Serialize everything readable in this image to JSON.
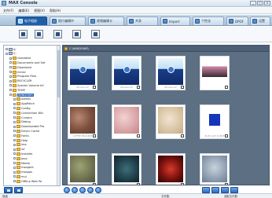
{
  "window": {
    "title": "MAX Console",
    "controls": [
      "_",
      "□",
      "×"
    ]
  },
  "menubar": {
    "items": [
      "文件(F)",
      "编辑(E)",
      "视图(V)",
      "帮助(H)"
    ]
  },
  "tabs": [
    {
      "label": "电子相册",
      "icon": "album-icon",
      "active": true
    },
    {
      "label": "照片编辑中",
      "icon": "photo-edit-icon"
    },
    {
      "label": "视频编辑卡",
      "icon": "video-edit-icon"
    },
    {
      "label": "共享",
      "icon": "share-icon"
    },
    {
      "label": "Import",
      "icon": "import-icon"
    },
    {
      "label": "个性化",
      "icon": "personalize-icon"
    },
    {
      "label": "DPOF",
      "icon": "dpof-icon"
    },
    {
      "label": "设置",
      "icon": "settings-icon"
    }
  ],
  "toolbar": {
    "buttons": [
      "tool-button-1",
      "tool-button-2",
      "tool-button-3",
      "tool-button-4",
      "tool-button-5"
    ]
  },
  "tree": {
    "items": [
      {
        "label": "A:",
        "type": "drive",
        "indent": 0
      },
      {
        "label": "C:",
        "type": "drive",
        "indent": 0
      },
      {
        "label": "clsmaster",
        "type": "folder",
        "indent": 1
      },
      {
        "label": "Documents and Set",
        "type": "folder",
        "indent": 1
      },
      {
        "label": "Download",
        "type": "folder",
        "indent": 1
      },
      {
        "label": "mirror",
        "type": "folder",
        "indent": 1
      },
      {
        "label": "Program Files",
        "type": "folder",
        "indent": 1
      },
      {
        "label": "RECYCLER",
        "type": "folder",
        "indent": 1
      },
      {
        "label": "System Volume Inf",
        "type": "folder",
        "indent": 1
      },
      {
        "label": "TEMP",
        "type": "folder",
        "indent": 1
      },
      {
        "label": "WINDOWS",
        "type": "folder",
        "indent": 1,
        "selected": true
      },
      {
        "label": "addins",
        "type": "folder",
        "indent": 2
      },
      {
        "label": "AppPatch",
        "type": "folder",
        "indent": 2
      },
      {
        "label": "Config",
        "type": "folder",
        "indent": 2
      },
      {
        "label": "Connection Wiz",
        "type": "folder",
        "indent": 2
      },
      {
        "label": "Cursors",
        "type": "folder",
        "indent": 2
      },
      {
        "label": "Debug",
        "type": "folder",
        "indent": 2
      },
      {
        "label": "Downloaded Pro",
        "type": "folder",
        "indent": 2
      },
      {
        "label": "Driver Cache",
        "type": "folder",
        "indent": 2
      },
      {
        "label": "Fonts",
        "type": "folder",
        "indent": 2
      },
      {
        "label": "Help",
        "type": "folder",
        "indent": 2
      },
      {
        "label": "ime",
        "type": "folder",
        "indent": 2
      },
      {
        "label": "inf",
        "type": "folder",
        "indent": 2
      },
      {
        "label": "Installer",
        "type": "folder",
        "indent": 2
      },
      {
        "label": "java",
        "type": "folder",
        "indent": 2
      },
      {
        "label": "Media",
        "type": "folder",
        "indent": 2
      },
      {
        "label": "msagent",
        "type": "folder",
        "indent": 2
      },
      {
        "label": "msapps",
        "type": "folder",
        "indent": 2
      },
      {
        "label": "mui",
        "type": "folder",
        "indent": 2
      },
      {
        "label": "Offline Web Pa",
        "type": "folder",
        "indent": 2
      }
    ]
  },
  "path_bar": {
    "text": "C:\\WINDOWS\\"
  },
  "thumbnails": [
    {
      "caption": "Windows XP",
      "style": "img-intro"
    },
    {
      "caption": "Windows XP",
      "style": "img-intro"
    },
    {
      "caption": "Windows XP",
      "style": "img-intro"
    },
    {
      "caption": "",
      "style": "img-photo"
    },
    {
      "caption": "COFFEE BEAN.BMP",
      "style": "img-tex-brown"
    },
    {
      "caption": "",
      "style": "img-tex-pink"
    },
    {
      "caption": "",
      "style": "img-tex-cream"
    },
    {
      "caption": "BLUE LACE 16.BMP",
      "style": "img-blue-square"
    },
    {
      "caption": "",
      "style": "img-tex-mossy"
    },
    {
      "caption": "",
      "style": "img-tex-teal"
    },
    {
      "caption": "",
      "style": "img-tex-red"
    },
    {
      "caption": "",
      "style": "img-tex-grey"
    }
  ],
  "status": {
    "left": "就绪",
    "mid": "文件数:",
    "right": "选取文件数:"
  }
}
